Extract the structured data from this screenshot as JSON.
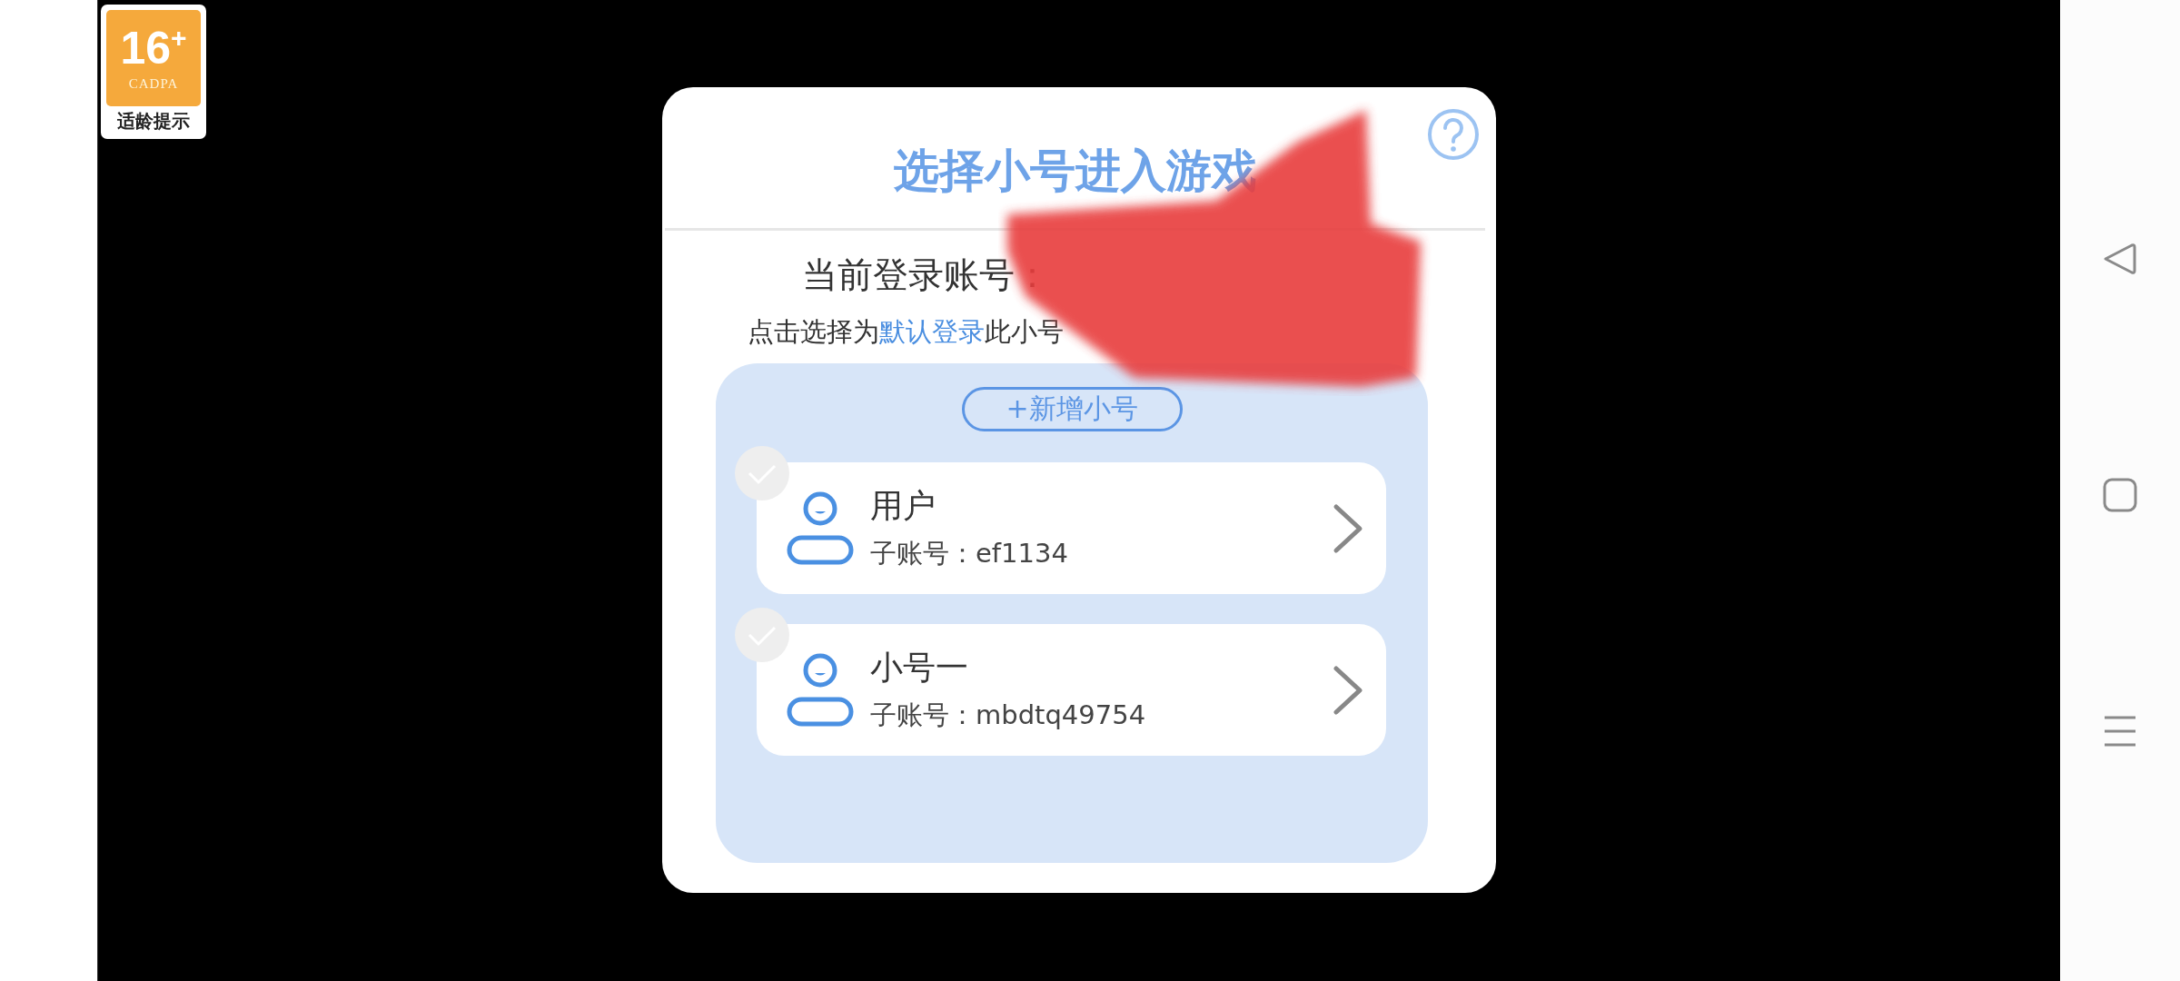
{
  "age_badge": {
    "rating": "16$^{+}$",
    "org": "CADPA",
    "caption": "适龄提示"
  },
  "dialog": {
    "title": "选择小号进入游戏",
    "current_account_label": "当前登录账号：",
    "hint": "点击选择为**默认登录**此小号",
    "add_button": "+新增小号",
    "accounts": [
      {
        "name": "用户",
        "sub_account": "子账号：ef1134",
        "selected": false
      },
      {
        "name": "小号一",
        "sub_account": "子账号：mbdtq49754",
        "selected": false
      }
    ]
  }
}
